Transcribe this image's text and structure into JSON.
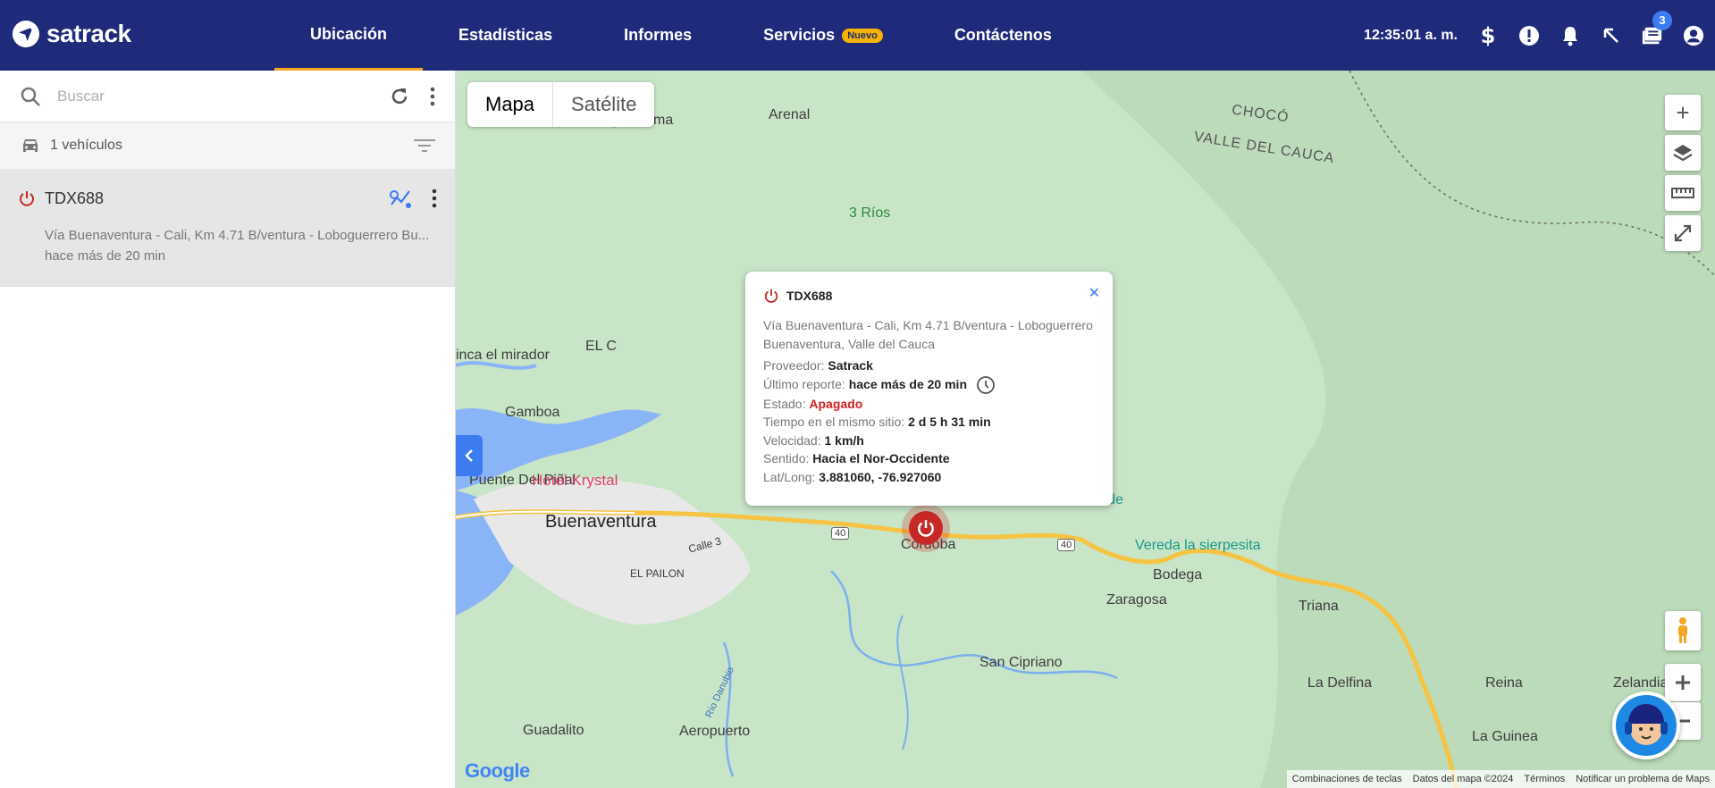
{
  "header": {
    "brand": "satrack",
    "nav": [
      {
        "label": "Ubicación"
      },
      {
        "label": "Estadísticas"
      },
      {
        "label": "Informes"
      },
      {
        "label": "Servicios",
        "badge": "Nuevo"
      },
      {
        "label": "Contáctenos"
      }
    ],
    "clock": "12:35:01 a. m.",
    "notification_count": "3"
  },
  "sidebar": {
    "search_placeholder": "Buscar",
    "vehicle_count": "1 vehículos",
    "vehicles": [
      {
        "plate": "TDX688",
        "address": "Vía Buenaventura - Cali, Km 4.71 B/ventura - Loboguerrero Bu...",
        "last_seen": "hace más de 20 min"
      }
    ]
  },
  "map": {
    "types": [
      "Mapa",
      "Satélite"
    ],
    "labels": {
      "bajo_calima": "Bajo Calima",
      "arenal": "Arenal",
      "choco": "CHOCÓ",
      "valle": "VALLE DEL CAUCA",
      "tres_rios": "3 Ríos",
      "mirador": "inca el mirador",
      "el_c": "EL C",
      "gamboa": "Gamboa",
      "puente": "Puente Del Piñal",
      "hotel": "Hotel Krystal",
      "buenaventura": "Buenaventura",
      "el_pailon": "EL PAILON",
      "calle3": "Calle 3",
      "cordoba": "Córdoba",
      "vereda_verde": "Vereda Verde",
      "sierpesita": "Vereda la sierpesita",
      "bodega": "Bodega",
      "zaragosa": "Zaragosa",
      "triana": "Triana",
      "san_cipriano": "San Cipriano",
      "la_delfina": "La Delfina",
      "reina": "Reina",
      "zelandia": "Zelandia",
      "la_guinea": "La Guinea",
      "guadalito": "Guadalito",
      "aeropuerto": "Aeropuerto",
      "rio_danubio": "Río Danubio",
      "route40a": "40",
      "route40b": "40"
    },
    "popup": {
      "plate": "TDX688",
      "address": "Vía Buenaventura - Cali, Km 4.71 B/ventura - Loboguerrero Buenaventura, Valle del Cauca",
      "provider_label": "Proveedor:",
      "provider": "Satrack",
      "report_label": "Último reporte:",
      "report": "hace más de 20 min",
      "state_label": "Estado:",
      "state": "Apagado",
      "time_label": "Tiempo en el mismo sitio:",
      "time": "2 d 5 h 31 min",
      "speed_label": "Velocidad:",
      "speed": "1 km/h",
      "dir_label": "Sentido:",
      "dir": "Hacia el Nor-Occidente",
      "latlong_label": "Lat/Long:",
      "latlong": "3.881060, -76.927060"
    },
    "attribution": [
      "Combinaciones de teclas",
      "Datos del mapa ©2024",
      "Términos",
      "Notificar un problema de Maps"
    ],
    "google": "Google"
  },
  "colors": {
    "topbar": "#1f2b7a",
    "accent": "#3d7bf0",
    "off_red": "#c62828",
    "map_land": "#c9e5c7",
    "water": "#8ab4f8",
    "road": "#f6c342"
  }
}
